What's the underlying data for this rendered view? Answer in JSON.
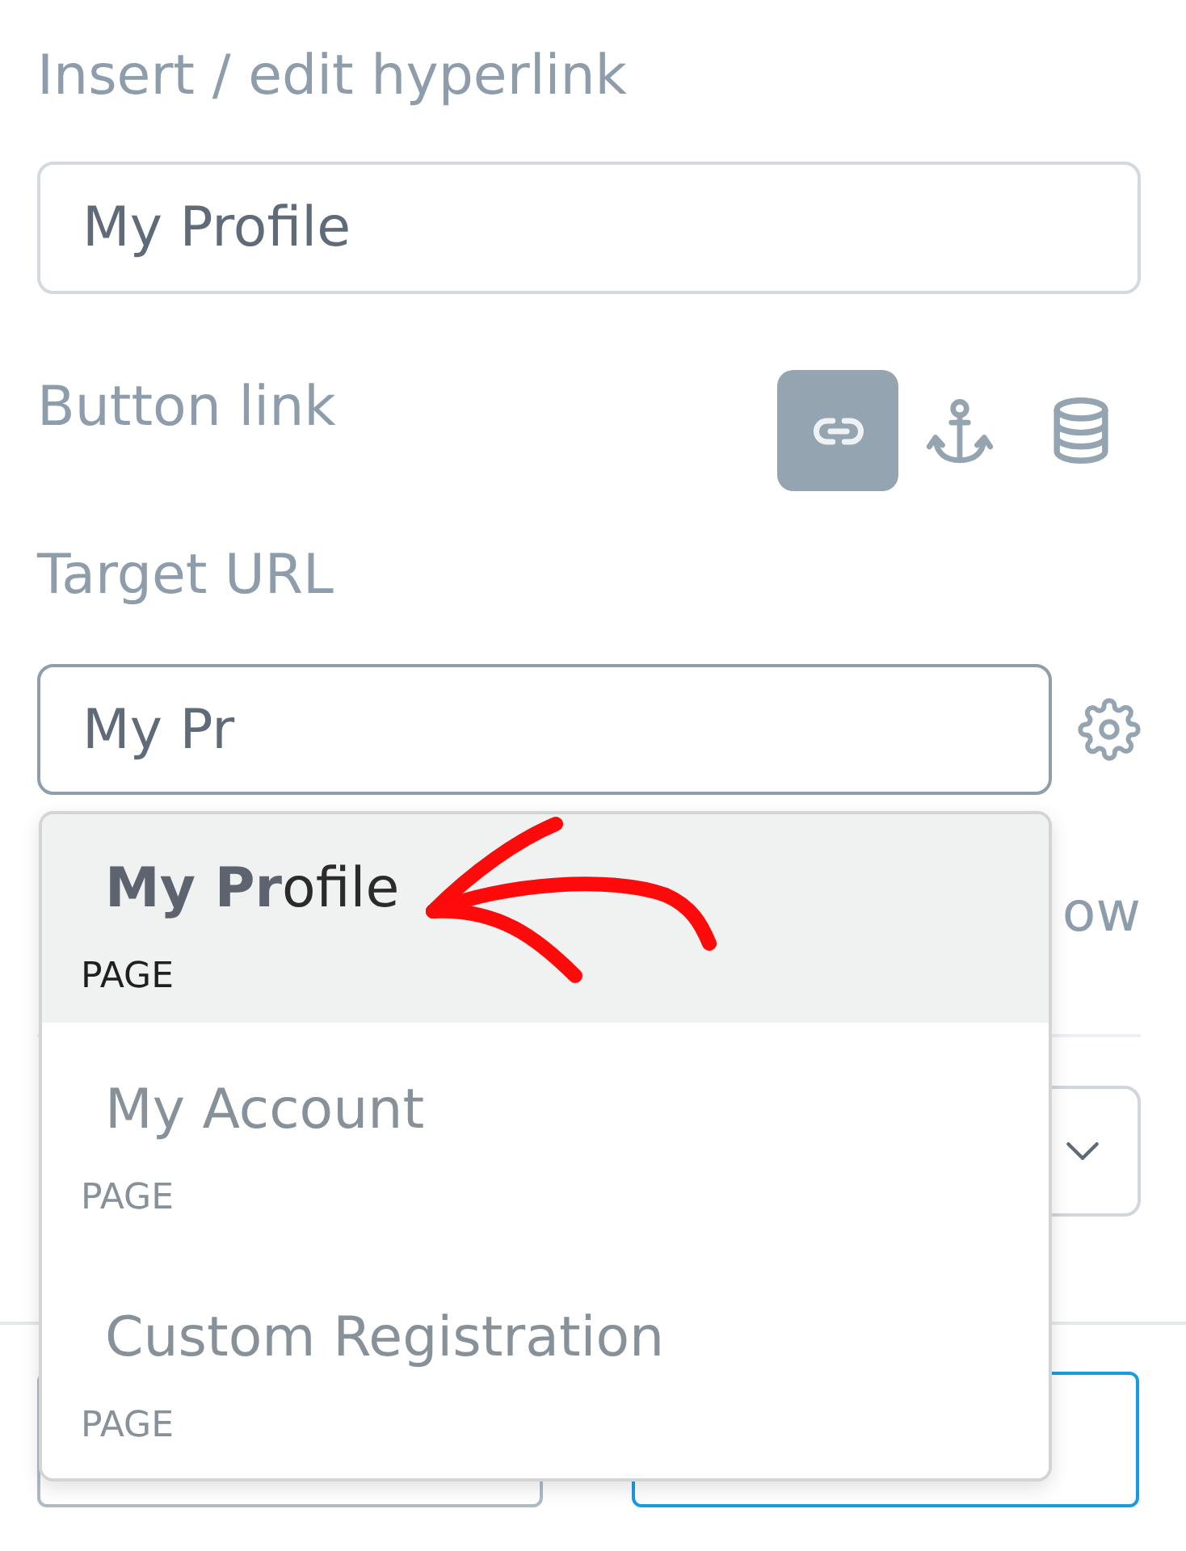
{
  "title": "Insert / edit hyperlink",
  "text_field": {
    "value": "My Profile"
  },
  "button_link": {
    "label": "Button link",
    "link_types": [
      {
        "kind": "link",
        "selected": true
      },
      {
        "kind": "anchor",
        "selected": false
      },
      {
        "kind": "database",
        "selected": false
      }
    ]
  },
  "target_url": {
    "label": "Target URL",
    "value": "My Pr",
    "suggestions": [
      {
        "title": "**My Pr**ofile",
        "type": "PAGE",
        "selected": true
      },
      {
        "title": "My Account",
        "type": "PAGE",
        "selected": false
      },
      {
        "title": "Custom Registration",
        "type": "PAGE",
        "selected": false
      }
    ]
  },
  "row_label": "ow",
  "footer": {
    "buttons": [
      {
        "kind": "secondary"
      },
      {
        "kind": "primary"
      }
    ]
  }
}
